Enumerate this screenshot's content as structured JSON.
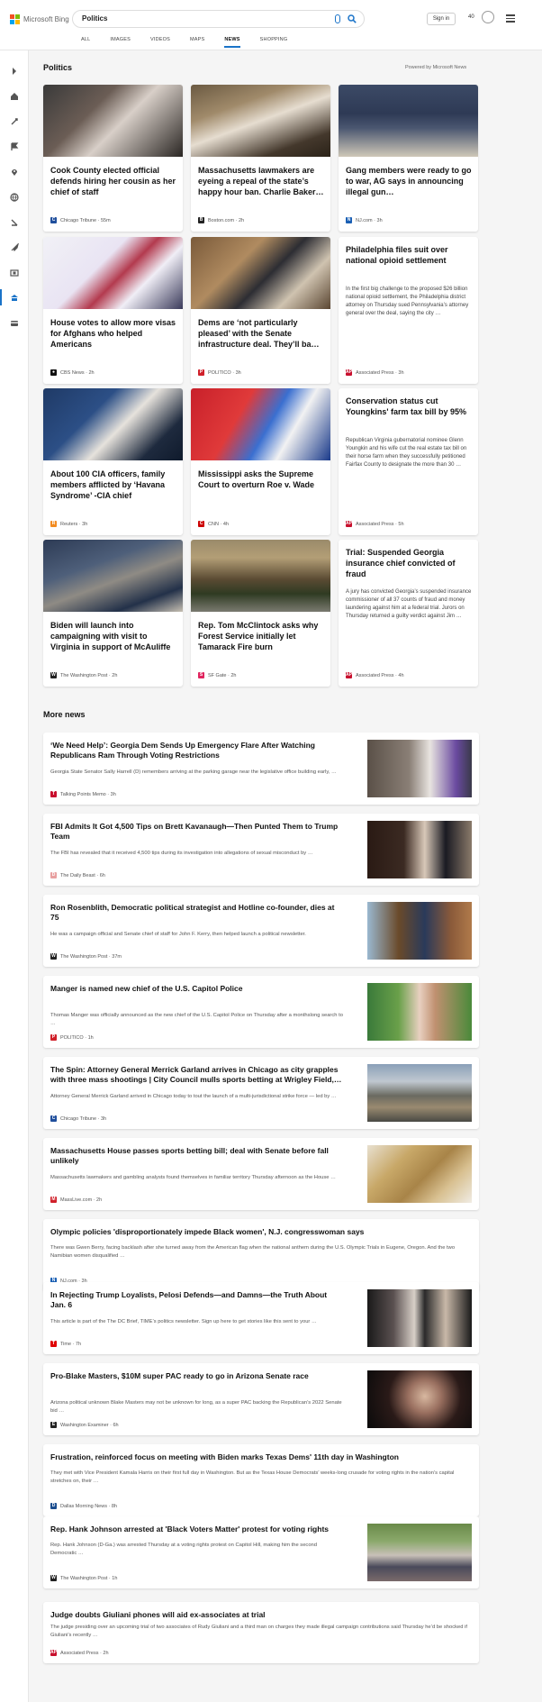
{
  "header": {
    "logo_text": "Microsoft Bing",
    "search_value": "Politics",
    "signin_label": "Sign in",
    "rewards_points": "40",
    "tabs": [
      {
        "label": "ALL"
      },
      {
        "label": "IMAGES"
      },
      {
        "label": "VIDEOS"
      },
      {
        "label": "MAPS"
      },
      {
        "label": "NEWS",
        "active": true
      },
      {
        "label": "SHOPPING"
      }
    ]
  },
  "rail": {
    "icons": [
      "chevron-right-icon",
      "home-icon",
      "sparkle-icon",
      "flag-icon",
      "location-pin-icon",
      "globe-icon",
      "pencil-ruler-icon",
      "rocket-icon",
      "film-icon",
      "bank-icon",
      "credit-card-icon"
    ]
  },
  "section": {
    "title": "Politics",
    "powered_by": "Powered by Microsoft News"
  },
  "cards": [
    {
      "title": "Cook County elected official defends hiring her cousin as her chief of staff",
      "source": "Chicago Tribune",
      "time": "55m",
      "fav_color": "#1f4e9c",
      "fav_letter": "C"
    },
    {
      "title": "Massachusetts lawmakers are eyeing a repeal of the state’s happy hour ban. Charlie Baker…",
      "source": "Boston.com",
      "time": "2h",
      "fav_color": "#222222",
      "fav_letter": "B"
    },
    {
      "title": "Gang members were ready to go to war, AG says in announcing illegal gun…",
      "source": "NJ.com",
      "time": "3h",
      "fav_color": "#1a5fb4",
      "fav_letter": "N"
    },
    {
      "title": "House votes to allow more visas for Afghans who helped Americans",
      "source": "CBS News",
      "time": "2h",
      "fav_color": "#111111",
      "fav_letter": "●"
    },
    {
      "title": "Dems are ‘not particularly pleased’ with the Senate infrastructure deal. They’ll ba…",
      "source": "POLITICO",
      "time": "3h",
      "fav_color": "#d0202a",
      "fav_letter": "P"
    },
    {
      "title": "Philadelphia files suit over national opioid settlement",
      "snippet": "In the first big challenge to the proposed $26 billion national opioid settlement, the Philadelphia district attorney on Thursday sued Pennsylvania’s attorney general over the deal, saying the city …",
      "source": "Associated Press",
      "time": "3h",
      "fav_color": "#c8102e",
      "fav_letter": "AP"
    },
    {
      "title": "About 100 CIA officers, family members afflicted by ‘Havana Syndrome’ -CIA chief",
      "source": "Reuters",
      "time": "3h",
      "fav_color": "#f28b20",
      "fav_letter": "R"
    },
    {
      "title": "Mississippi asks the Supreme Court to overturn Roe v. Wade",
      "source": "CNN",
      "time": "4h",
      "fav_color": "#cc0000",
      "fav_letter": "C"
    },
    {
      "title": "Conservation status cut Youngkins' farm tax bill by 95%",
      "snippet": "Republican Virginia gubernatorial nominee Glenn Youngkin and his wife cut the real estate tax bill on their horse farm when they successfully petitioned Fairfax County to designate the more than 30 …",
      "source": "Associated Press",
      "time": "5h",
      "fav_color": "#c8102e",
      "fav_letter": "AP"
    },
    {
      "title": "Biden will launch into campaigning with visit to Virginia in support of McAuliffe",
      "source": "The Washington Post",
      "time": "2h",
      "fav_color": "#222222",
      "fav_letter": "W"
    },
    {
      "title": "Rep. Tom McClintock asks why Forest Service initially let Tamarack Fire burn",
      "source": "SF Gate",
      "time": "2h",
      "fav_color": "#e0245e",
      "fav_letter": "S"
    },
    {
      "title": "Trial: Suspended Georgia insurance chief convicted of fraud",
      "snippet": "A jury has convicted Georgia’s suspended insurance commissioner of all 37 counts of fraud and money laundering against him at a federal trial. Jurors on Thursday returned a guilty verdict against Jim …",
      "source": "Associated Press",
      "time": "4h",
      "fav_color": "#c8102e",
      "fav_letter": "AP"
    }
  ],
  "more_news": {
    "title": "More news",
    "items": [
      {
        "title": "‘We Need Help’: Georgia Dem Sends Up Emergency Flare After Watching Republicans Ram Through Voting Restrictions",
        "snippet": "Georgia State Senator Sally Harrell (D) remembers arriving at the parking garage near the legislative office building early, …",
        "source": "Talking Points Memo",
        "time": "3h",
        "fav_color": "#c8102e",
        "fav_letter": "T"
      },
      {
        "title": "FBI Admits It Got 4,500 Tips on Brett Kavanaugh—Then Punted Them to Trump Team",
        "snippet": "The FBI has revealed that it received 4,500 tips during its investigation into allegations of sexual misconduct by …",
        "source": "The Daily Beast",
        "time": "6h",
        "fav_color": "#e8a0a0",
        "fav_letter": "D"
      },
      {
        "title": "Ron Rosenblith, Democratic political strategist and Hotline co-founder, dies at 75",
        "snippet": "He was a campaign official and Senate chief of staff for John F. Kerry, then helped launch a political newsletter.",
        "source": "The Washington Post",
        "time": "37m",
        "fav_color": "#222222",
        "fav_letter": "W"
      },
      {
        "title": "Manger is named new chief of the U.S. Capitol Police",
        "snippet": "Thomas Manger was officially announced as the new chief of the U.S. Capitol Police on Thursday after a monthslong search to …",
        "source": "POLITICO",
        "time": "1h",
        "fav_color": "#d0202a",
        "fav_letter": "P"
      },
      {
        "title": "The Spin: Attorney General Merrick Garland arrives in Chicago as city grapples with three mass shootings | City Council mulls sports betting at Wrigley Field,…",
        "snippet": "Attorney General Merrick Garland arrived in Chicago today to tout the launch of a multi-jurisdictional strike force — led by …",
        "source": "Chicago Tribune",
        "time": "3h",
        "fav_color": "#1f4e9c",
        "fav_letter": "C"
      },
      {
        "title": "Massachusetts House passes sports betting bill; deal with Senate before fall unlikely",
        "snippet": "Massachusetts lawmakers and gambling analysts found themselves in familiar territory Thursday afternoon as the House …",
        "source": "MassLive.com",
        "time": "2h",
        "fav_color": "#d0202a",
        "fav_letter": "M"
      },
      {
        "title": "Olympic policies 'disproportionately impede Black women', N.J. congresswoman says",
        "snippet": "There was Gwen Berry, facing backlash after she turned away from the American flag when the national anthem during the U.S. Olympic Trials in Eugene, Oregon. And the two Namibian women disqualified …",
        "source": "NJ.com",
        "time": "3h",
        "fav_color": "#1a5fb4",
        "fav_letter": "N"
      },
      {
        "title": "In Rejecting Trump Loyalists, Pelosi Defends—and Damns—the Truth About Jan. 6",
        "snippet": "This article is part of the The DC Brief, TIME’s politics newsletter. Sign up here to get stories like this sent to your …",
        "source": "Time",
        "time": "7h",
        "fav_color": "#e00000",
        "fav_letter": "T"
      },
      {
        "title": "Pro-Blake Masters, $10M super PAC ready to go in Arizona Senate race",
        "snippet": "Arizona political unknown Blake Masters may not be unknown for long, as a super PAC backing the Republican’s 2022 Senate bid …",
        "source": "Washington Examiner",
        "time": "6h",
        "fav_color": "#222222",
        "fav_letter": "E"
      },
      {
        "title": "Frustration, reinforced focus on meeting with Biden marks Texas Dems' 11th day in Washington",
        "snippet": "They met with Vice President Kamala Harris on their first full day in Washington. But as the Texas House Democrats’ weeks-long crusade for voting rights in the nation’s capital stretches on, their …",
        "source": "Dallas Morning News",
        "time": "8h",
        "fav_color": "#1a4d8f",
        "fav_letter": "D"
      },
      {
        "title": "Rep. Hank Johnson arrested at 'Black Voters Matter' protest for voting rights",
        "snippet": "Rep. Hank Johnson (D-Ga.) was arrested Thursday at a voting rights protest on Capitol Hill, making him the second Democratic …",
        "source": "The Washington Post",
        "time": "1h",
        "fav_color": "#222222",
        "fav_letter": "W"
      },
      {
        "title": "Judge doubts Giuliani phones will aid ex-associates at trial",
        "snippet": "The judge presiding over an upcoming trial of two associates of Rudy Giuliani and a third man on charges they made illegal campaign contributions said Thursday he’d be shocked if Giuliani’s recently …",
        "source": "Associated Press",
        "time": "2h",
        "fav_color": "#c8102e",
        "fav_letter": "AP"
      }
    ]
  }
}
